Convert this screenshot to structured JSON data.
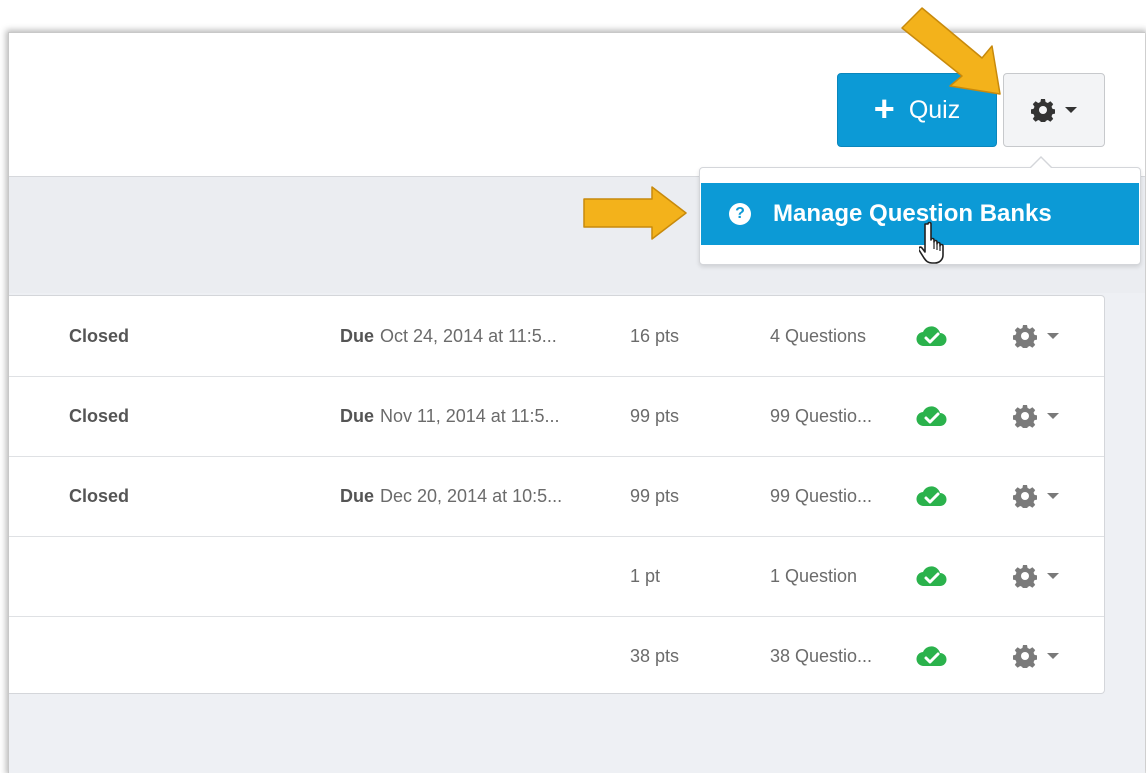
{
  "toolbar": {
    "quiz_plus": "+",
    "quiz_label": "Quiz"
  },
  "menu": {
    "manage_question_banks": "Manage Question Banks",
    "help_glyph": "?"
  },
  "quizzes": [
    {
      "status": "Closed",
      "due_prefix": "Due",
      "due": "Oct 24, 2014 at 11:5...",
      "points": "16 pts",
      "questions": "4 Questions"
    },
    {
      "status": "Closed",
      "due_prefix": "Due",
      "due": "Nov 11, 2014 at 11:5...",
      "points": "99 pts",
      "questions": "99 Questio..."
    },
    {
      "status": "Closed",
      "due_prefix": "Due",
      "due": "Dec 20, 2014 at 10:5...",
      "points": "99 pts",
      "questions": "99 Questio..."
    },
    {
      "status": "",
      "due_prefix": "",
      "due": "",
      "points": "1 pt",
      "questions": "1 Question"
    },
    {
      "status": "",
      "due_prefix": "",
      "due": "",
      "points": "38 pts",
      "questions": "38 Questio..."
    }
  ],
  "colors": {
    "primary": "#0c9ad6",
    "published_green": "#2bb24c",
    "annotation_arrow": "#f3b21b"
  },
  "icons": {
    "settings": "gear-icon",
    "published": "cloud-check-icon",
    "help": "question-circle-icon",
    "cursor": "hand-pointer-icon"
  }
}
